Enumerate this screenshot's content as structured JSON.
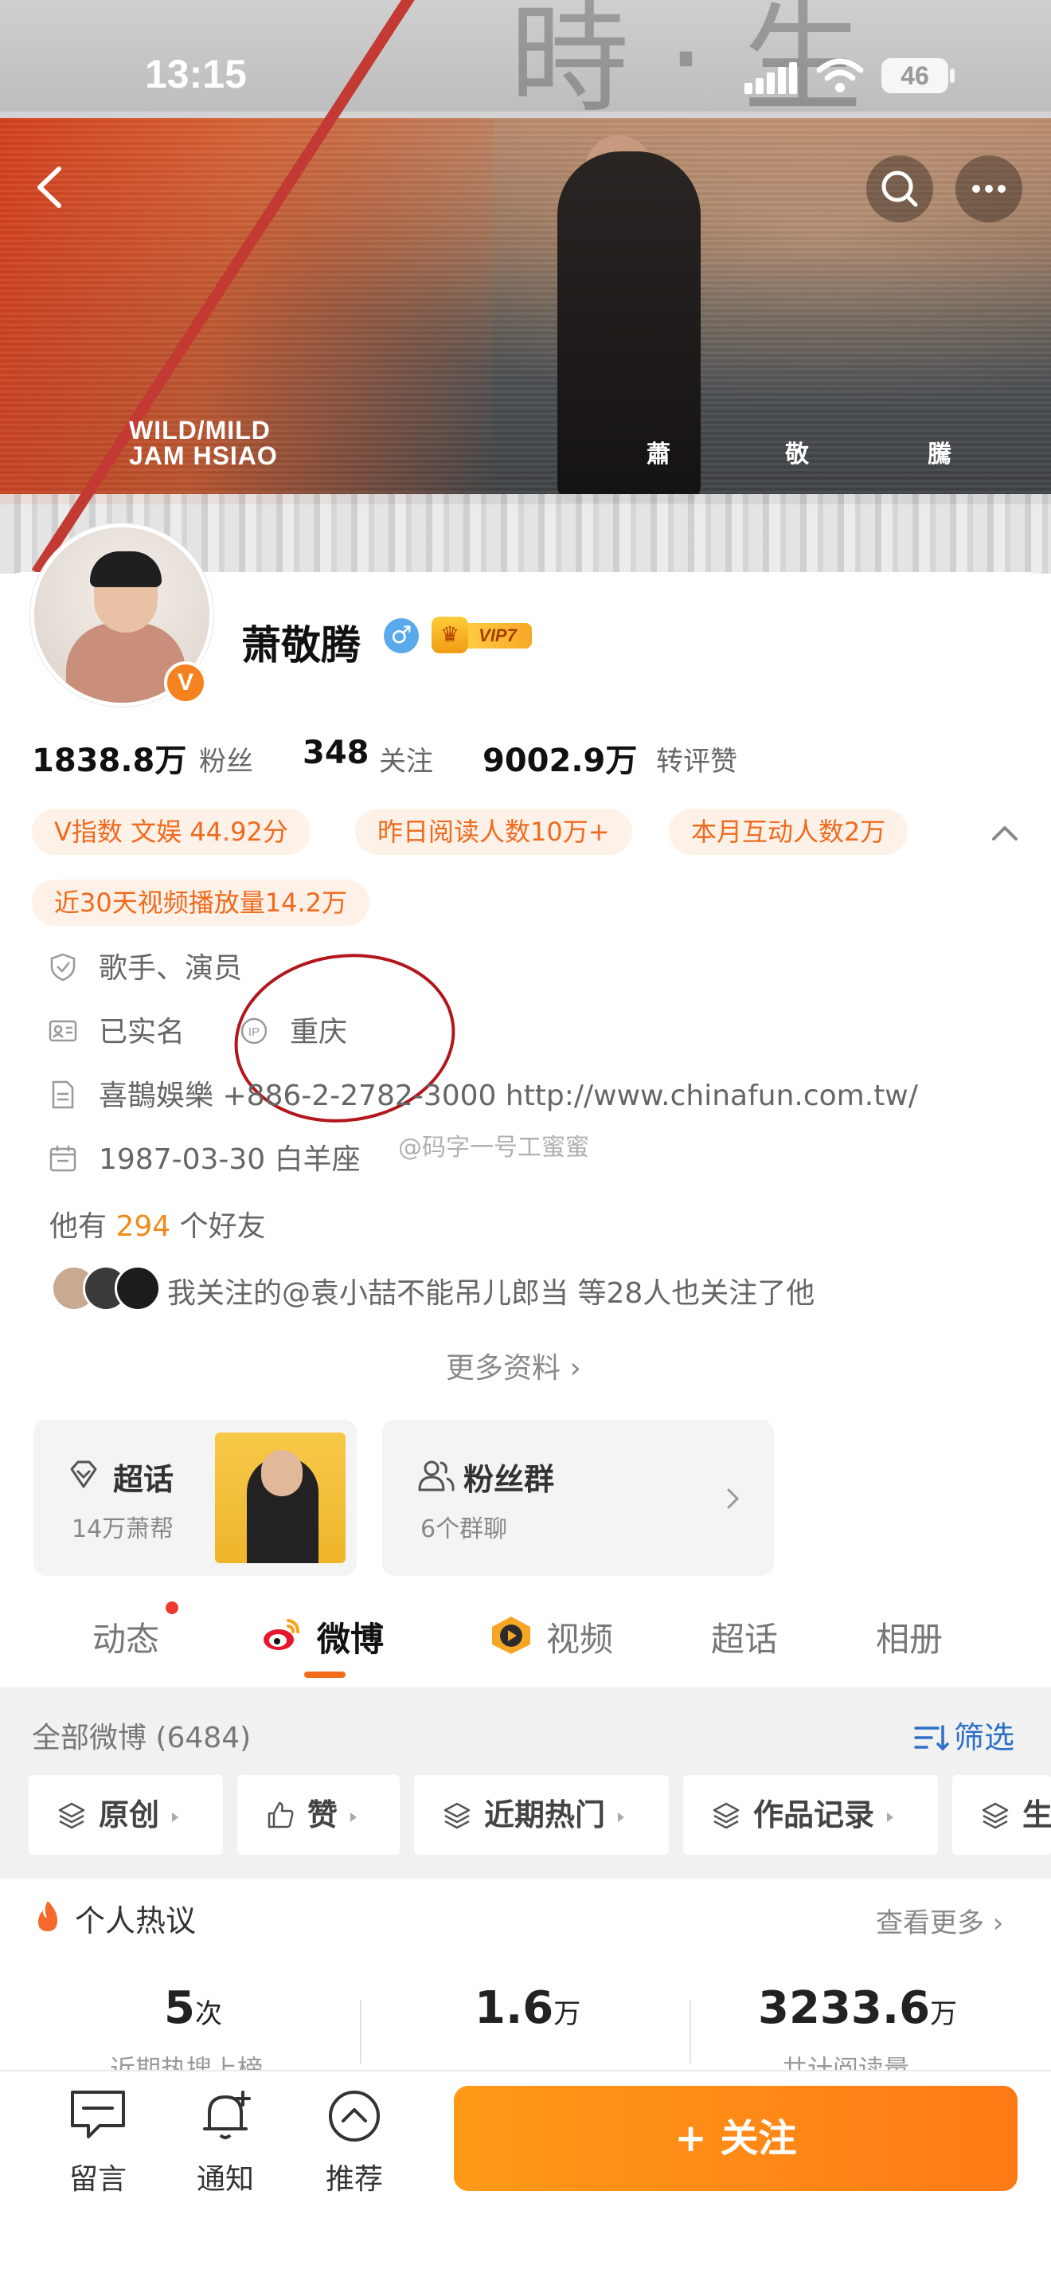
{
  "status_bar": {
    "time": "13:15",
    "battery": "46"
  },
  "banner": {
    "album_line1": "WILD/MILD",
    "album_line2": "JAM HSIAO",
    "vertical_chars": [
      "蕭",
      "敬",
      "騰"
    ]
  },
  "profile": {
    "name": "萧敬腾",
    "gender_symbol": "♂",
    "vip_label": "VIP7",
    "verified_mark": "V",
    "stats": [
      {
        "value": "1838.8万",
        "label": "粉丝"
      },
      {
        "value": "348",
        "label": "关注"
      },
      {
        "value": "9002.9万",
        "label": "转评赞"
      }
    ],
    "chips": [
      "V指数 文娱 44.92分",
      "昨日阅读人数10万+",
      "本月互动人数2万",
      "近30天视频播放量14.2万"
    ],
    "info": {
      "occupation": "歌手、演员",
      "real_name_status": "已实名",
      "ip_location": "重庆",
      "company": "喜鵲娛樂 +886-2-2782-3000 http://www.chinafun.com.tw/",
      "birthday": "1987-03-30 白羊座"
    },
    "watermark": "@码字一号工蜜蜜",
    "friends_prefix": "他有",
    "friends_count": "294",
    "friends_suffix": "个好友",
    "mutual_follow_text": "我关注的@袁小喆不能吊儿郎当 等28人也关注了他",
    "more_info": "更多资料 ›"
  },
  "cards": {
    "topic": {
      "title": "超话",
      "sub": "14万萧帮"
    },
    "fans": {
      "title": "粉丝群",
      "sub": "6个群聊"
    }
  },
  "tabs": [
    "动态",
    "微博",
    "视频",
    "超话",
    "相册"
  ],
  "feed": {
    "all_label": "全部微博 (6484)",
    "filter_label": "筛选",
    "tags": [
      "原创",
      "赞",
      "近期热门",
      "作品记录",
      "生"
    ]
  },
  "hot": {
    "title": "个人热议",
    "see_more": "查看更多 ›",
    "items": [
      {
        "num": "5",
        "unit": "次",
        "label": "近期热搜上榜"
      },
      {
        "num": "1.6",
        "unit": "万",
        "label": ""
      },
      {
        "num": "3233.6",
        "unit": "万",
        "label": "共计阅读量"
      }
    ]
  },
  "bottom_bar": {
    "comment": "留言",
    "notify": "通知",
    "recommend": "推荐",
    "follow": "+ 关注"
  },
  "colors": {
    "accent": "#ff8a17",
    "link_blue": "#2e6fc7",
    "chip_text": "#f06a1c",
    "ip_circle": "#b2161c"
  }
}
